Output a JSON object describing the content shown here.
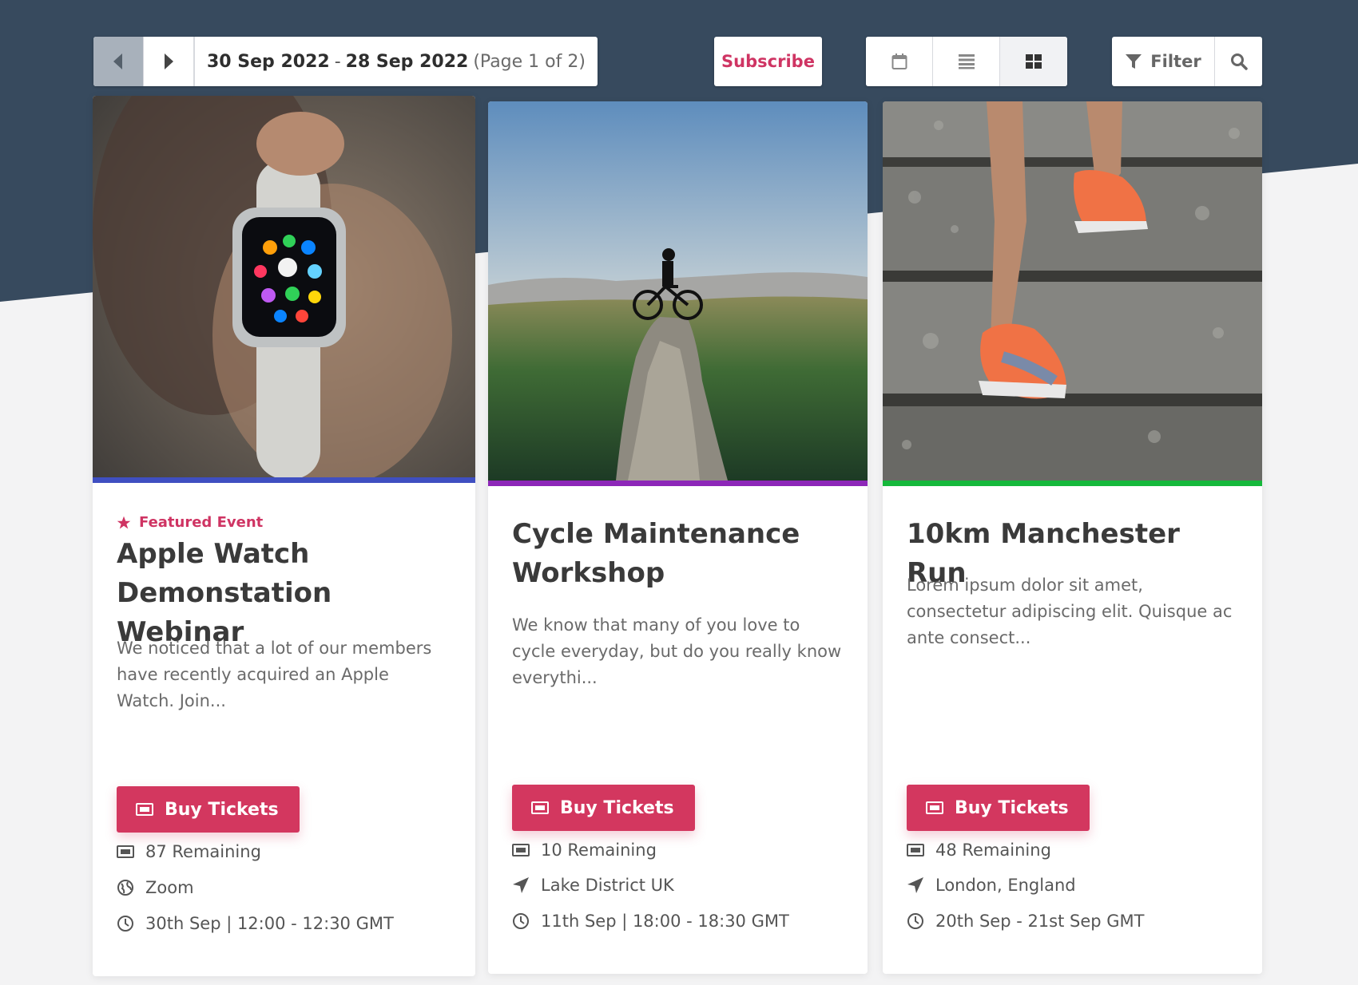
{
  "toolbar": {
    "date_start": "30 Sep 2022",
    "date_separator": "-",
    "date_end": "28 Sep 2022",
    "page_info": "(Page 1 of 2)",
    "subscribe_label": "Subscribe",
    "filter_label": "Filter",
    "prev_icon": "chevron-left-icon",
    "next_icon": "chevron-right-icon",
    "views": [
      "calendar-view-icon",
      "list-view-icon",
      "grid-view-icon"
    ],
    "active_view": "grid"
  },
  "colors": {
    "header_bg": "#374a5e",
    "brand_pink": "#d3375f",
    "accent_blue": "#3f4fc1",
    "accent_purple": "#8d27b8",
    "accent_green": "#16b83b"
  },
  "events": [
    {
      "featured_label": "Featured Event",
      "title": "Apple Watch Demonstation Webinar",
      "description": "We noticed that a lot of our members have recently acquired an Apple Watch. Join...",
      "button_label": "Buy Tickets",
      "remaining": "87 Remaining",
      "location": "Zoom",
      "location_icon": "globe-icon",
      "datetime": "30th Sep | 12:00 - 12:30 GMT",
      "accent": "#3f4fc1"
    },
    {
      "title": "Cycle Maintenance Workshop",
      "description": "We know that many of you love to cycle everyday, but do you really know everythi...",
      "button_label": "Buy Tickets",
      "remaining": "10 Remaining",
      "location": "Lake District UK",
      "location_icon": "location-arrow-icon",
      "datetime": "11th Sep | 18:00 - 18:30 GMT",
      "accent": "#8d27b8"
    },
    {
      "title": "10km Manchester Run",
      "description": "Lorem ipsum dolor sit amet, consectetur adipiscing elit. Quisque ac ante consect...",
      "button_label": "Buy Tickets",
      "remaining": "48 Remaining",
      "location": "London, England",
      "location_icon": "location-arrow-icon",
      "datetime": "20th Sep - 21st Sep GMT",
      "accent": "#16b83b"
    }
  ]
}
